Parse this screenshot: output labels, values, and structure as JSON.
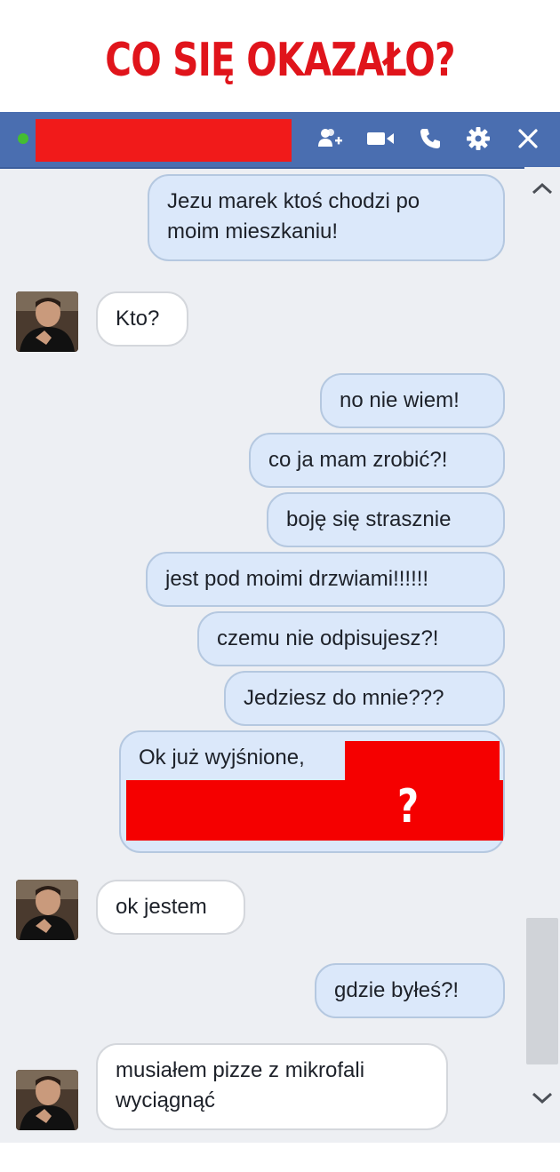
{
  "headline": "CO SIĘ OKAZAŁO?",
  "titlebar": {
    "icons": [
      "online-status-dot",
      "add-person-icon",
      "video-call-icon",
      "voice-call-icon",
      "gear-icon",
      "close-icon"
    ]
  },
  "messages": [
    {
      "side": "out",
      "lines": [
        "Jezu marek ktoś chodzi po",
        "moim mieszkaniu!"
      ]
    },
    {
      "side": "in",
      "lines": [
        "Kto?"
      ]
    },
    {
      "side": "out",
      "lines": [
        "no nie wiem!"
      ]
    },
    {
      "side": "out",
      "lines": [
        "co ja mam zrobić?!"
      ]
    },
    {
      "side": "out",
      "lines": [
        "boję się strasznie"
      ]
    },
    {
      "side": "out",
      "lines": [
        "jest pod moimi drzwiami!!!!!!"
      ]
    },
    {
      "side": "out",
      "lines": [
        "czemu nie odpisujesz?!"
      ]
    },
    {
      "side": "out",
      "lines": [
        "Jedziesz do mnie???"
      ]
    },
    {
      "side": "out",
      "lines": [
        "Ok już wyjśnione,"
      ],
      "redaction_overlay_text": "?"
    },
    {
      "side": "in",
      "lines": [
        "ok jestem"
      ]
    },
    {
      "side": "out",
      "lines": [
        "gdzie byłeś?!"
      ]
    },
    {
      "side": "in",
      "lines": [
        "musiałem pizze z mikrofali",
        "wyciągnąć"
      ]
    }
  ],
  "scrollbar": {
    "up_icon": "chevron-up-icon",
    "down_icon": "chevron-down-icon"
  },
  "colors": {
    "headline": "#e0141b",
    "titlebar": "#4a6eb0",
    "outgoing_bubble": "#dbe8fa",
    "incoming_bubble": "#ffffff",
    "redaction": "#f50000",
    "chat_background": "#edeff3"
  }
}
